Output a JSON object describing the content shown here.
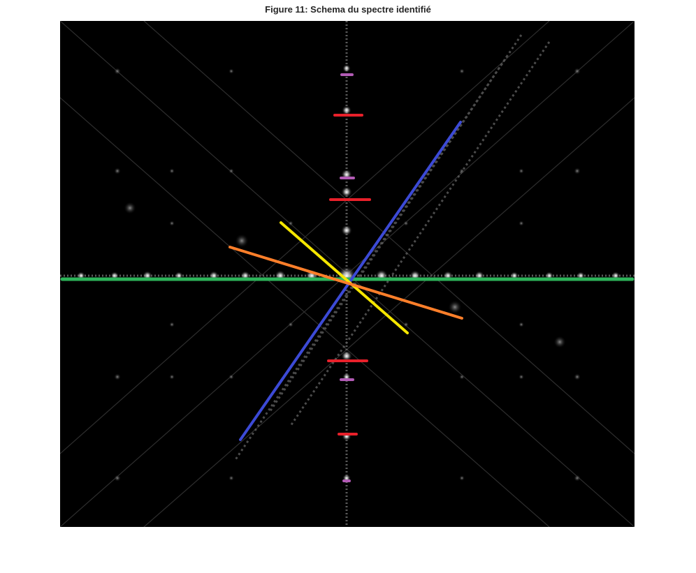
{
  "figure": {
    "title": "Figure 11: Schema du spectre identifié"
  },
  "colors": {
    "background": "#000000",
    "green": "#2db45a",
    "blue": "#3c4ad6",
    "yellow": "#f5e600",
    "orange": "#ff7f2a",
    "red": "#e8202a",
    "purple": "#b25bb5"
  }
}
